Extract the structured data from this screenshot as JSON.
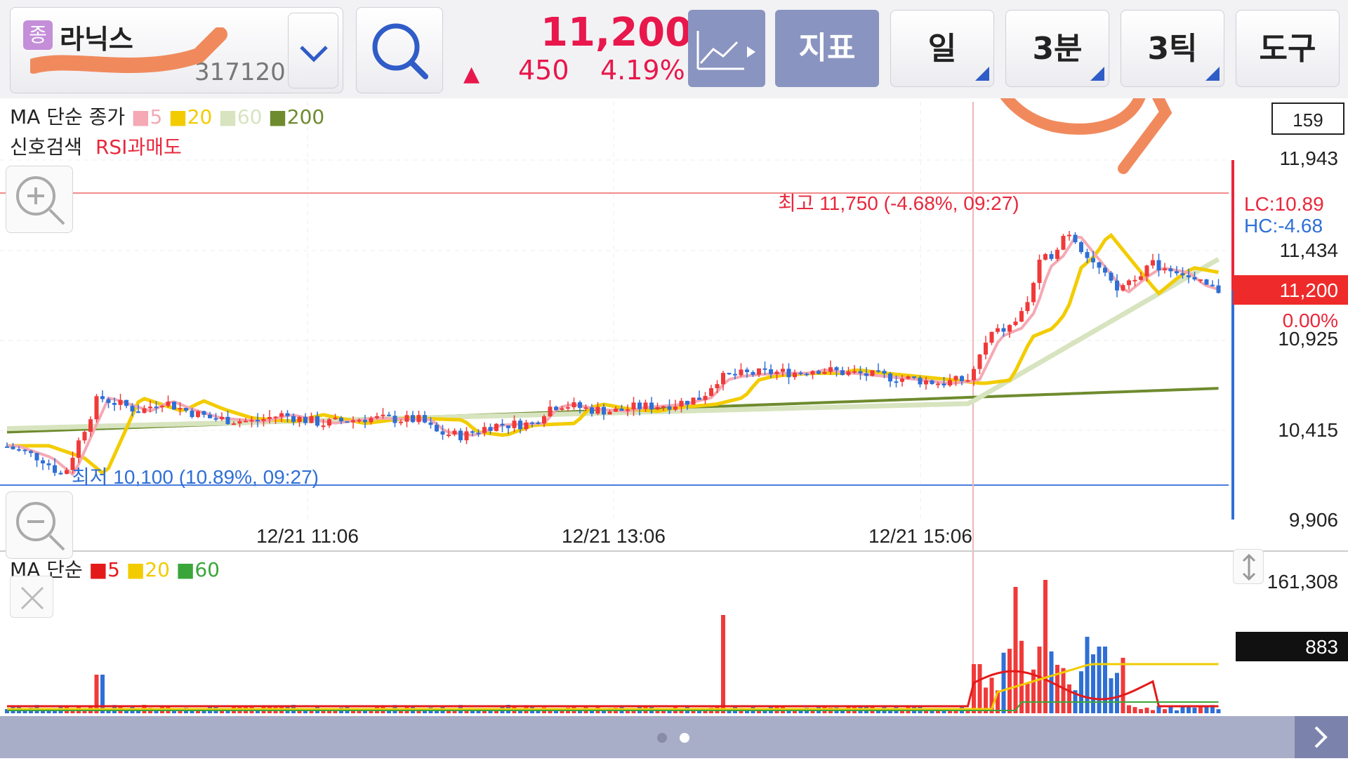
{
  "header": {
    "stock_badge": "종",
    "stock_name": "라닉스",
    "stock_code": "317120",
    "price": "11,200",
    "change_arrow": "▲",
    "change": "450",
    "change_pct": "4.19%",
    "indicator_label": "지표",
    "period_day": "일",
    "period_min": "3분",
    "period_tick": "3틱",
    "tools_label": "도구"
  },
  "price_panel": {
    "ma_label": "MA 단순 종가",
    "ma_periods": [
      "5",
      "20",
      "60",
      "200"
    ],
    "signal_label": "신호검색",
    "signal_value": "RSI과매도",
    "high_label": "최고 11,750 (-4.68%, 09:27)",
    "low_label": "최저 10,100 (10.89%, 09:27)",
    "count_box": "159",
    "lc_label": "LC:10.89",
    "hc_label": "HC:-4.68",
    "current_price_box": "11,200",
    "current_pct": "0.00%",
    "y_ticks": [
      "11,943",
      "11,434",
      "10,925",
      "10,415",
      "9,906"
    ],
    "x_ticks": [
      "12/21 11:06",
      "12/21 13:06",
      "12/21 15:06"
    ]
  },
  "volume_panel": {
    "ma_label": "MA 단순",
    "ma_periods": [
      "5",
      "20",
      "60"
    ],
    "max_label": "161,308",
    "current_box": "883"
  },
  "colors": {
    "up": "#f03a3a",
    "down": "#2f6fd6",
    "ma5_price": "#f4a9b4",
    "ma20_price": "#f2cc00",
    "ma60_price": "#d7e4bf",
    "ma200_price": "#6e8b2e",
    "ma5_vol": "#e41a1a",
    "ma20_vol": "#f2cc00",
    "ma60_vol": "#3aa63a"
  },
  "chart_data": {
    "type": "candlestick",
    "price_range": [
      9906,
      11943
    ],
    "high": 11750,
    "low": 10100,
    "last": 11200
  }
}
